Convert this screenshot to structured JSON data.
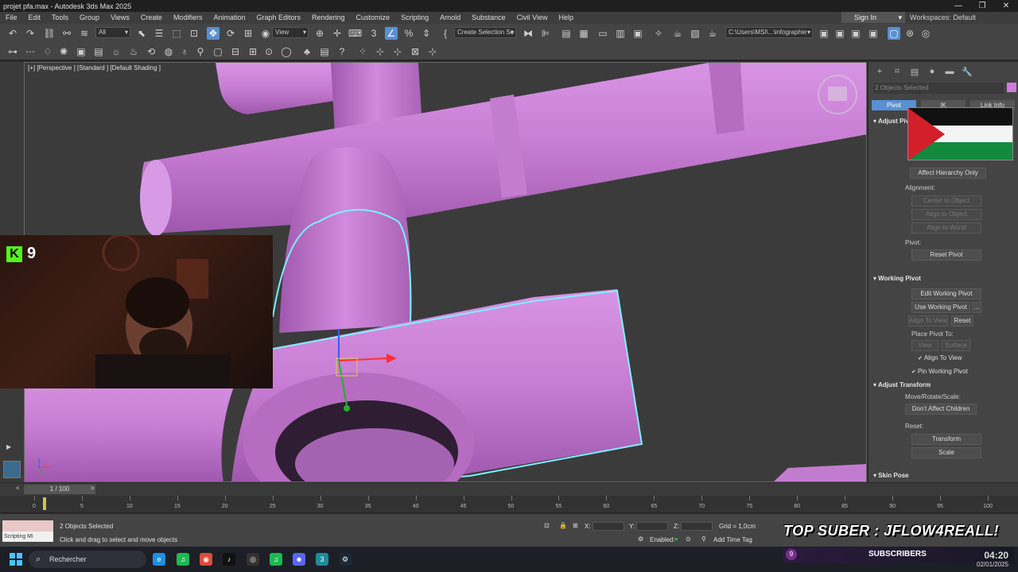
{
  "window": {
    "title": "projet pfa.max - Autodesk 3ds Max 2025",
    "minimize": "—",
    "maximize": "❐",
    "close": "✕"
  },
  "menu": [
    "File",
    "Edit",
    "Tools",
    "Group",
    "Views",
    "Create",
    "Modifiers",
    "Animation",
    "Graph Editors",
    "Rendering",
    "Customize",
    "Scripting",
    "Arnold",
    "Substance",
    "Civil View",
    "Help"
  ],
  "account": {
    "signin": "Sign In",
    "workspaces_label": "Workspaces:",
    "workspaces_value": "Default"
  },
  "toolbar": {
    "selection_filter": "All",
    "ref_coord": "View",
    "named_selection": "Create Selection Se",
    "project_path": "C:\\Users\\MSI\\...\\infographie"
  },
  "viewport": {
    "label": "[+] [Perspective ] [Standard ] [Default Shading ]",
    "object_color": "#c880d4",
    "selection_color": "#7ef0ff"
  },
  "stream": {
    "kick_count": "9"
  },
  "command_panel": {
    "selection": "2 Objects Selected",
    "tabs": [
      "Pivot",
      "IK",
      "Link Info"
    ],
    "adjust_pivot": "Adjust Pivot",
    "affect_hierarchy": "Affect Hierarchy Only",
    "alignment_label": "Alignment:",
    "center_to_object": "Center to Object",
    "align_to_object": "Align to Object",
    "align_to_world": "Align to World",
    "pivot_label": "Pivot:",
    "reset_pivot": "Reset Pivot",
    "working_pivot": "Working Pivot",
    "edit_working_pivot": "Edit Working Pivot",
    "use_working_pivot": "Use Working Pivot",
    "use_wp_more": "...",
    "align_to_view": "Align To View",
    "reset": "Reset",
    "place_pivot_to": "Place Pivot To:",
    "view": "View",
    "surface": "Surface",
    "align_to_view_check": "Align To View",
    "pin_working_pivot": "Pin Working Pivot",
    "adjust_transform": "Adjust Transform",
    "move_rotate_scale": "Move/Rotate/Scale:",
    "dont_affect_children": "Don't Affect Children",
    "reset_label": "Reset:",
    "transform": "Transform",
    "scale": "Scale",
    "skin_pose": "Skin Pose"
  },
  "timeline": {
    "frame": "1 / 100",
    "prev": "<",
    "next": ">",
    "ticks": [
      "0",
      "5",
      "10",
      "15",
      "20",
      "25",
      "30",
      "35",
      "40",
      "45",
      "50",
      "55",
      "60",
      "65",
      "70",
      "75",
      "80",
      "85",
      "90",
      "95",
      "100"
    ]
  },
  "status": {
    "script_label": "Scripting Mi",
    "selected": "2 Objects Selected",
    "prompt": "Click and drag to select and move objects",
    "x_label": "X:",
    "y_label": "Y:",
    "z_label": "Z:",
    "grid": "Grid = 1,0cm",
    "enabled": "Enabled:",
    "add_time_tag": "Add Time Tag"
  },
  "overlay": {
    "top_suber": "TOP SUBER : JFLOW4REALL!",
    "sub_count": "9",
    "subscribers": "SUBSCRIBERS"
  },
  "taskbar": {
    "search": "Rechercher",
    "time": "04:20",
    "date": "02/01/2025"
  }
}
